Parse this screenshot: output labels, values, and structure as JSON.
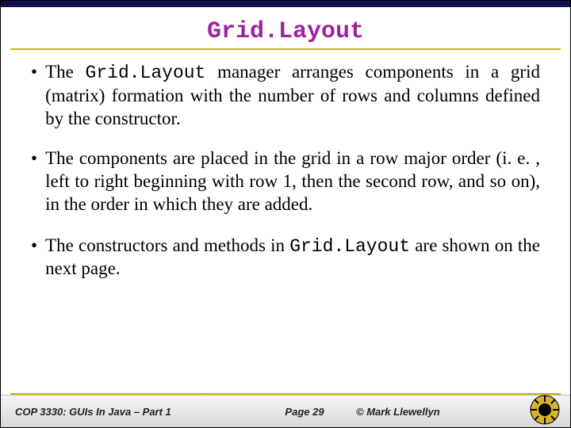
{
  "title": "Grid.Layout",
  "bullets": [
    {
      "prefix": "The ",
      "code": "Grid.Layout",
      "rest": " manager arranges components in a grid (matrix) formation with the number of rows and columns defined by the constructor."
    },
    {
      "prefix": "The components are placed in the grid in a row major order (i. e. , left to right beginning with row 1, then the second row, and so on), in the order in which they are added.",
      "code": "",
      "rest": ""
    },
    {
      "prefix": "The constructors and methods in ",
      "code": "Grid.Layout",
      "rest": " are shown on the next page."
    }
  ],
  "footer": {
    "course": "COP 3330:  GUIs In Java – Part 1",
    "page": "Page 29",
    "copyright": "© Mark Llewellyn"
  }
}
